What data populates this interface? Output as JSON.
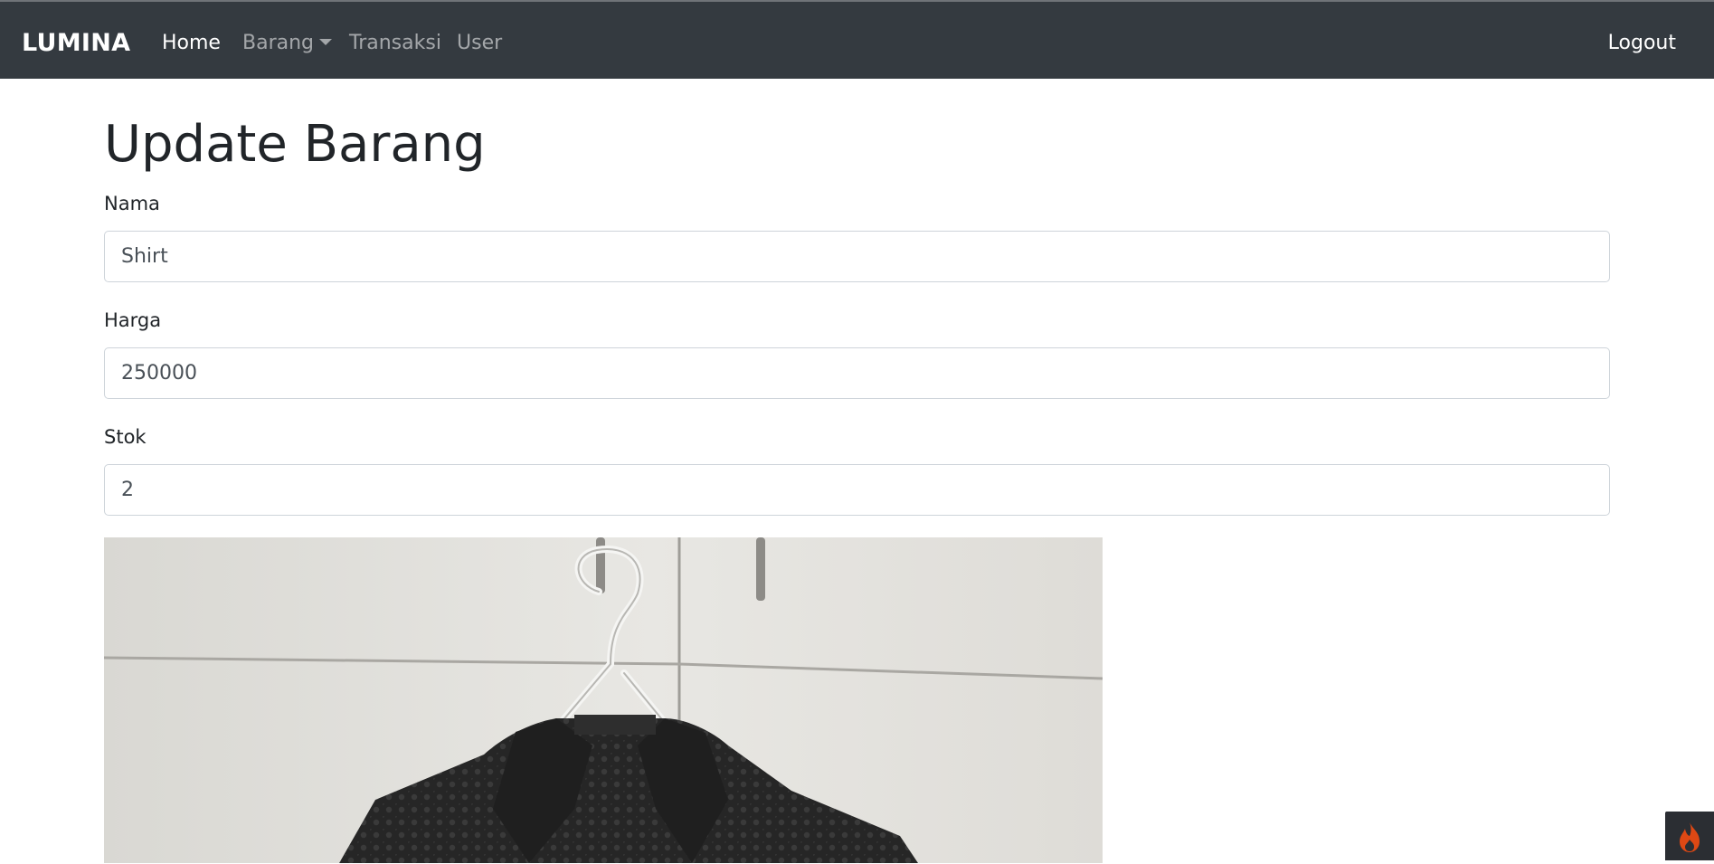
{
  "navbar": {
    "brand": "LUMINA",
    "items": [
      {
        "label": "Home"
      },
      {
        "label": "Barang"
      },
      {
        "label": "Transaksi"
      },
      {
        "label": "User"
      }
    ],
    "logout": "Logout"
  },
  "page": {
    "title": "Update Barang"
  },
  "form": {
    "nama": {
      "label": "Nama",
      "value": "Shirt"
    },
    "harga": {
      "label": "Harga",
      "value": "250000"
    },
    "stok": {
      "label": "Stok",
      "value": "2"
    }
  },
  "colors": {
    "navbar_bg": "#343a40",
    "text": "#212529",
    "input_border": "#ced4da",
    "debug_flame": "#dd4814"
  },
  "icons": {
    "dropdown": "caret-down-icon",
    "debug_toolbar": "flame-icon"
  }
}
